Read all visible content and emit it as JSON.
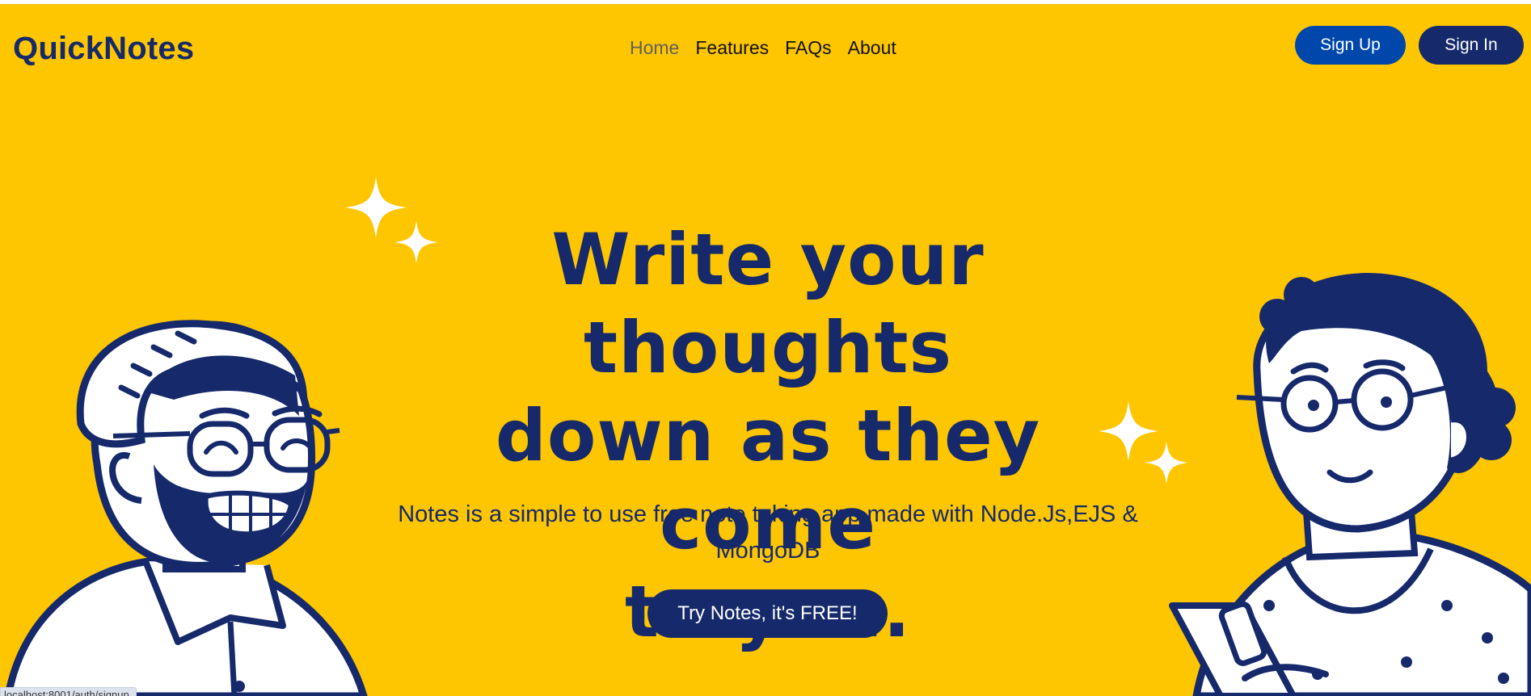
{
  "header": {
    "brand": "QuickNotes",
    "nav": [
      {
        "label": "Home",
        "active": true
      },
      {
        "label": "Features",
        "active": false
      },
      {
        "label": "FAQs",
        "active": false
      },
      {
        "label": "About",
        "active": false
      }
    ],
    "signup_label": "Sign Up",
    "signin_label": "Sign In"
  },
  "hero": {
    "headline_line1": "Write your thoughts",
    "headline_line2": "down as they come",
    "headline_line3": "to you.",
    "subtext": "Notes is a simple to use free note taking app made with Node.Js,EJS & MongoDB",
    "cta_label": "Try Notes, it's FREE!"
  },
  "status": {
    "url": "localhost:8001/auth/signup"
  },
  "colors": {
    "background": "#FEC601",
    "navy": "#15296B",
    "signup_blue": "#0047AB"
  },
  "icons": [
    "sparkle-icon",
    "man-with-glasses-illustration",
    "woman-with-phone-illustration"
  ]
}
